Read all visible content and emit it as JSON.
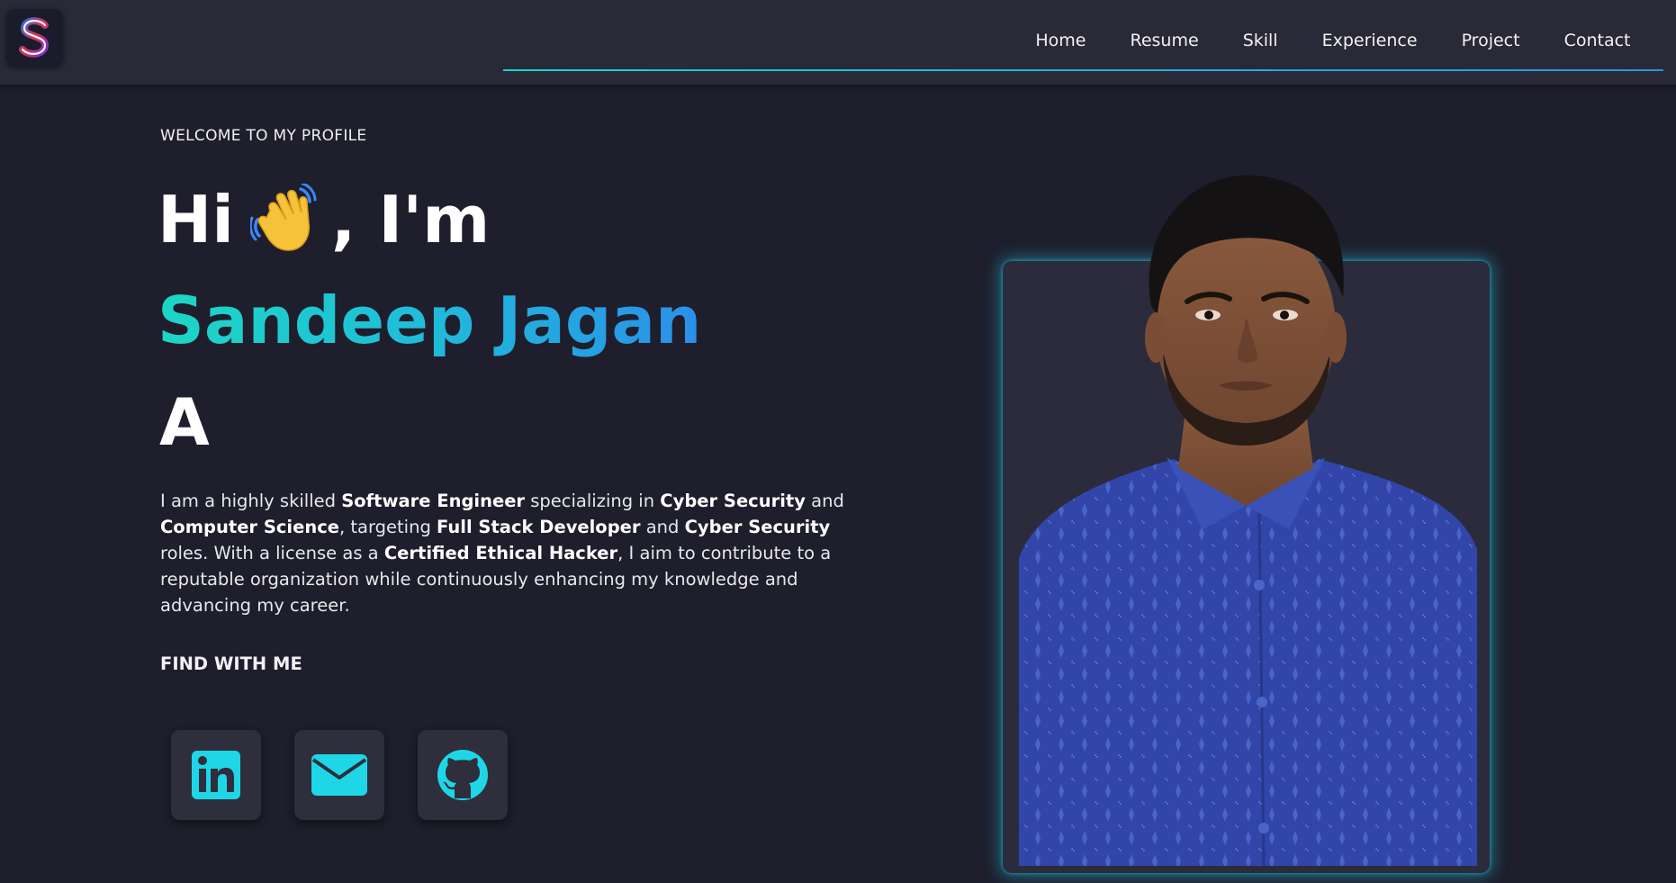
{
  "header": {
    "logo_letter": "S",
    "nav": [
      "Home",
      "Resume",
      "Skill",
      "Experience",
      "Project",
      "Contact"
    ]
  },
  "hero": {
    "welcome": "WELCOME TO MY PROFILE",
    "greeting_prefix": "Hi",
    "greeting_suffix": ", I'm",
    "name": "Sandeep Jagan",
    "typed_text": "A",
    "intro": [
      {
        "t": "I am a highly skilled ",
        "b": false
      },
      {
        "t": "Software Engineer",
        "b": true
      },
      {
        "t": " specializing in ",
        "b": false
      },
      {
        "t": "Cyber Security",
        "b": true
      },
      {
        "t": " and ",
        "b": false
      },
      {
        "t": "Computer Science",
        "b": true
      },
      {
        "t": ", targeting ",
        "b": false
      },
      {
        "t": "Full Stack Developer",
        "b": true
      },
      {
        "t": " and ",
        "b": false
      },
      {
        "t": "Cyber Security",
        "b": true
      },
      {
        "t": " roles. With a license as a ",
        "b": false
      },
      {
        "t": "Certified Ethical Hacker",
        "b": true
      },
      {
        "t": ", I aim to contribute to a reputable organization while continuously enhancing my knowledge and advancing my career.",
        "b": false
      }
    ],
    "find_label": "FIND WITH ME",
    "socials": [
      {
        "icon": "linkedin-icon"
      },
      {
        "icon": "mail-icon"
      },
      {
        "icon": "github-icon"
      }
    ]
  },
  "colors": {
    "background": "#1e1e2c",
    "header": "#292937",
    "accent_start": "#1dd6c4",
    "accent_end": "#2b8fe8",
    "icon": "#1fd6e6",
    "shirt": "#3046a6"
  }
}
